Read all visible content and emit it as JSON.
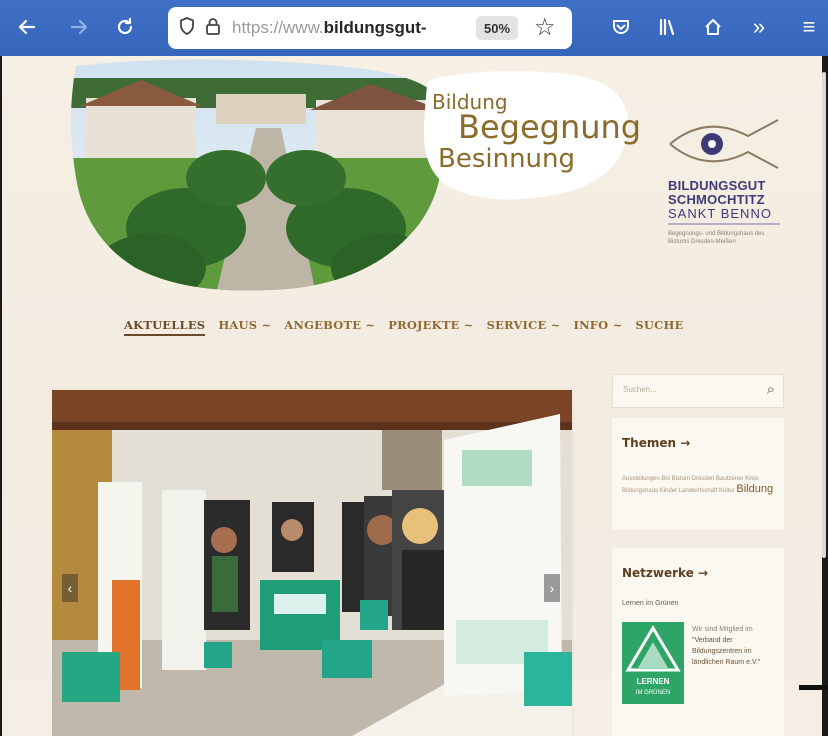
{
  "browser": {
    "url_prefix": "https://www.",
    "url_domain": "bildungsgut-",
    "zoom": "50%"
  },
  "header": {
    "tagline": [
      "Bildung",
      "Begegnung",
      "Besinnung"
    ],
    "brand": [
      "BILDUNGSGUT",
      "SCHMOCHTITZ",
      "SANKT BENNO"
    ],
    "brand_sub": "Begegnungs- und Bildungshaus des Bistums Dresden-Meißen"
  },
  "nav": {
    "items": [
      {
        "label": "AKTUELLES",
        "active": true
      },
      {
        "label": "HAUS ~"
      },
      {
        "label": "ANGEBOTE ~"
      },
      {
        "label": "PROJEKTE ~"
      },
      {
        "label": "SERVICE ~"
      },
      {
        "label": "INFO ~"
      },
      {
        "label": "SUCHE"
      }
    ]
  },
  "sidebar": {
    "search_placeholder": "Suchen...",
    "themen_title": "Themen →",
    "themen_text": "Ausstellungen Bio Bistum Dresden Bautzener Kreis Bildungshaus Kinder Landwirtschaft Kultur",
    "themen_big": "Bildung",
    "netzwerke_title": "Netzwerke →",
    "netzwerke_sub": "Lernen im Grünen",
    "netzwerke_text": "Wir sind Mitglied im",
    "netzwerke_quote": "\"Verband der Bildungszentren im ländlichen Raum e.V.\"",
    "logo_text": "LERNEN IM GRÜNEN"
  },
  "colors": {
    "toolbar": "#3f70c6",
    "page_bg": "#f3ece1",
    "nav_text": "#8f6a34",
    "brand": "#3e3a76",
    "green": "#2ea567"
  }
}
